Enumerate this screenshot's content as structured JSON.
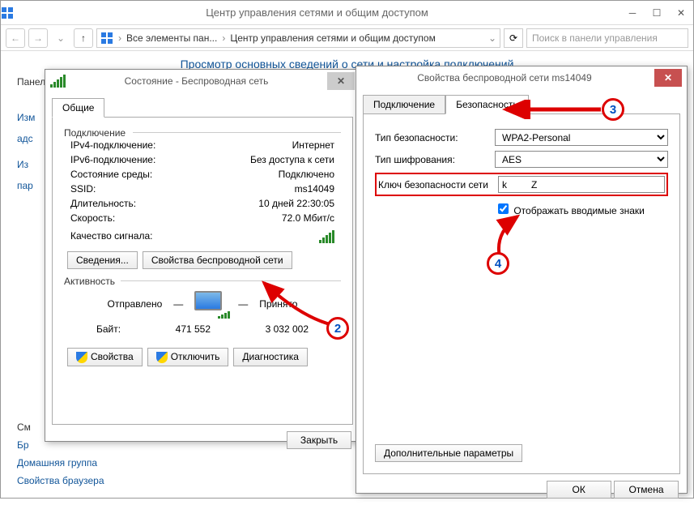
{
  "mainWindow": {
    "title": "Центр управления сетями и общим доступом",
    "addr_part1": "Все элементы пан...",
    "addr_part2": "Центр управления сетями и общим доступом",
    "search_placeholder": "Поиск в панели управления",
    "heading": "Просмотр основных сведений о сети и настройка подключений"
  },
  "leftPane": {
    "l1": "Панел",
    "l2": "Изм",
    "l3": "адс",
    "l4": "Из",
    "l5": "пар",
    "b1": "См",
    "b2": "Бр",
    "b3": "Домашняя группа",
    "b4": "Свойства браузера"
  },
  "statusDlg": {
    "title": "Состояние - Беспроводная сеть",
    "tab_general": "Общие",
    "grp_conn": "Подключение",
    "ipv4_l": "IPv4-подключение:",
    "ipv4_v": "Интернет",
    "ipv6_l": "IPv6-подключение:",
    "ipv6_v": "Без доступа к сети",
    "state_l": "Состояние среды:",
    "state_v": "Подключено",
    "ssid_l": "SSID:",
    "ssid_v": "ms14049",
    "dur_l": "Длительность:",
    "dur_v": "10 дней 22:30:05",
    "speed_l": "Скорость:",
    "speed_v": "72.0 Мбит/c",
    "sig_l": "Качество сигнала:",
    "btn_details": "Сведения...",
    "btn_wprops": "Свойства беспроводной сети",
    "grp_act": "Активность",
    "sent": "Отправлено",
    "recv": "Принято",
    "bytes_l": "Байт:",
    "bytes_sent": "471 552",
    "bytes_recv": "3 032 002",
    "btn_props": "Свойства",
    "btn_disc": "Отключить",
    "btn_diag": "Диагностика",
    "btn_close": "Закрыть"
  },
  "propDlg": {
    "title": "Свойства беспроводной сети ms14049",
    "tab_conn": "Подключение",
    "tab_sec": "Безопасность",
    "sec_type_l": "Тип безопасности:",
    "sec_type_v": "WPA2-Personal",
    "enc_l": "Тип шифрования:",
    "enc_v": "AES",
    "key_l": "Ключ безопасности сети",
    "key_v": "k         Z",
    "show_chars": "Отображать вводимые знаки",
    "btn_adv": "Дополнительные параметры",
    "btn_ok": "ОК",
    "btn_cancel": "Отмена"
  },
  "callouts": {
    "c2": "2",
    "c3": "3",
    "c4": "4"
  }
}
